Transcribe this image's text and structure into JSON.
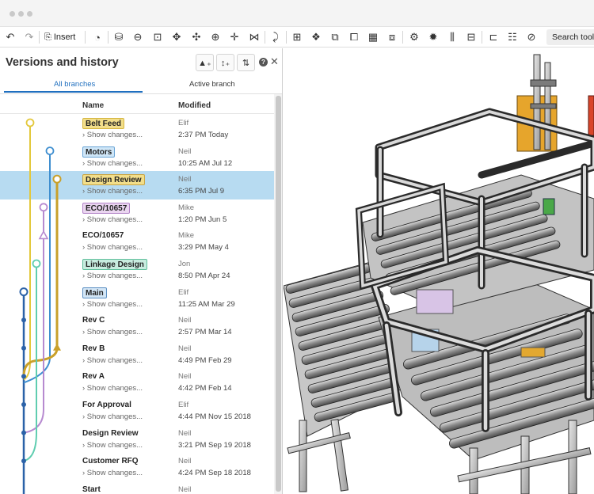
{
  "toolbar": {
    "insert_label": "Insert",
    "search_label": "Search tools"
  },
  "panel": {
    "title": "Versions and history",
    "tabs": [
      {
        "label": "All branches",
        "active": true
      },
      {
        "label": "Active branch",
        "active": false
      }
    ],
    "columns": {
      "name": "Name",
      "modified": "Modified"
    },
    "show_changes_label": "Show changes..."
  },
  "versions": [
    {
      "name": "Belt Feed",
      "user": "Elif",
      "date": "2:37 PM Today",
      "tag_color": "#f2de8a",
      "tag_border": "#d6b740"
    },
    {
      "name": "Motors",
      "user": "Neil",
      "date": "10:25 AM Jul 12",
      "tag_color": "#cfe6f7",
      "tag_border": "#6aa5d6"
    },
    {
      "name": "Design Review",
      "user": "Neil",
      "date": "6:35 PM Jul 9",
      "tag_color": "#f2de8a",
      "tag_border": "#c9a544",
      "selected": true
    },
    {
      "name": "ECO/10657",
      "user": "Mike",
      "date": "1:20 PM Jun 5",
      "tag_color": "#ead5f0",
      "tag_border": "#b283c7"
    },
    {
      "name": "ECO/10657",
      "user": "Mike",
      "date": "3:29 PM May 4"
    },
    {
      "name": "Linkage Design",
      "user": "Jon",
      "date": "8:50 PM Apr 24",
      "tag_color": "#c8ecdf",
      "tag_border": "#5fbf9b"
    },
    {
      "name": "Main",
      "user": "Elif",
      "date": "11:25 AM Mar 29",
      "tag_color": "#d3e6f6",
      "tag_border": "#5b8fc2"
    },
    {
      "name": "Rev C",
      "user": "Neil",
      "date": "2:57 PM Mar 14"
    },
    {
      "name": "Rev B",
      "user": "Neil",
      "date": "4:49 PM Feb 29"
    },
    {
      "name": "Rev A",
      "user": "Neil",
      "date": "4:42 PM Feb 14"
    },
    {
      "name": "For Approval",
      "user": "Elif",
      "date": "4:44 PM Nov 15 2018"
    },
    {
      "name": "Design Review",
      "user": "Neil",
      "date": "3:21 PM Sep 19 2018"
    },
    {
      "name": "Customer RFQ",
      "user": "Neil",
      "date": "4:24 PM Sep 18 2018"
    },
    {
      "name": "Start",
      "user": "Neil",
      "date": ""
    }
  ],
  "colors": {
    "accent": "#1f6fbf",
    "selected_row": "#b7dbf1",
    "branch_main": "#2b62a8",
    "branch_yellow": "#e3c83c",
    "branch_gold": "#c9a02a",
    "branch_blue": "#3f8fd0",
    "branch_purple": "#b78ad0",
    "branch_green": "#5fcdb0"
  }
}
